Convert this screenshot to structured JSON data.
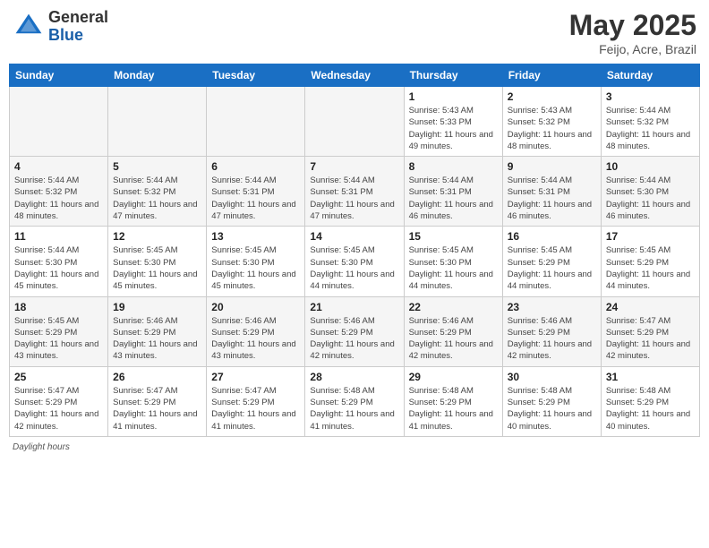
{
  "header": {
    "logo_general": "General",
    "logo_blue": "Blue",
    "title": "May 2025",
    "location": "Feijo, Acre, Brazil"
  },
  "days_of_week": [
    "Sunday",
    "Monday",
    "Tuesday",
    "Wednesday",
    "Thursday",
    "Friday",
    "Saturday"
  ],
  "weeks": [
    [
      {
        "day": "",
        "info": ""
      },
      {
        "day": "",
        "info": ""
      },
      {
        "day": "",
        "info": ""
      },
      {
        "day": "",
        "info": ""
      },
      {
        "day": "1",
        "info": "Sunrise: 5:43 AM\nSunset: 5:33 PM\nDaylight: 11 hours and 49 minutes."
      },
      {
        "day": "2",
        "info": "Sunrise: 5:43 AM\nSunset: 5:32 PM\nDaylight: 11 hours and 48 minutes."
      },
      {
        "day": "3",
        "info": "Sunrise: 5:44 AM\nSunset: 5:32 PM\nDaylight: 11 hours and 48 minutes."
      }
    ],
    [
      {
        "day": "4",
        "info": "Sunrise: 5:44 AM\nSunset: 5:32 PM\nDaylight: 11 hours and 48 minutes."
      },
      {
        "day": "5",
        "info": "Sunrise: 5:44 AM\nSunset: 5:32 PM\nDaylight: 11 hours and 47 minutes."
      },
      {
        "day": "6",
        "info": "Sunrise: 5:44 AM\nSunset: 5:31 PM\nDaylight: 11 hours and 47 minutes."
      },
      {
        "day": "7",
        "info": "Sunrise: 5:44 AM\nSunset: 5:31 PM\nDaylight: 11 hours and 47 minutes."
      },
      {
        "day": "8",
        "info": "Sunrise: 5:44 AM\nSunset: 5:31 PM\nDaylight: 11 hours and 46 minutes."
      },
      {
        "day": "9",
        "info": "Sunrise: 5:44 AM\nSunset: 5:31 PM\nDaylight: 11 hours and 46 minutes."
      },
      {
        "day": "10",
        "info": "Sunrise: 5:44 AM\nSunset: 5:30 PM\nDaylight: 11 hours and 46 minutes."
      }
    ],
    [
      {
        "day": "11",
        "info": "Sunrise: 5:44 AM\nSunset: 5:30 PM\nDaylight: 11 hours and 45 minutes."
      },
      {
        "day": "12",
        "info": "Sunrise: 5:45 AM\nSunset: 5:30 PM\nDaylight: 11 hours and 45 minutes."
      },
      {
        "day": "13",
        "info": "Sunrise: 5:45 AM\nSunset: 5:30 PM\nDaylight: 11 hours and 45 minutes."
      },
      {
        "day": "14",
        "info": "Sunrise: 5:45 AM\nSunset: 5:30 PM\nDaylight: 11 hours and 44 minutes."
      },
      {
        "day": "15",
        "info": "Sunrise: 5:45 AM\nSunset: 5:30 PM\nDaylight: 11 hours and 44 minutes."
      },
      {
        "day": "16",
        "info": "Sunrise: 5:45 AM\nSunset: 5:29 PM\nDaylight: 11 hours and 44 minutes."
      },
      {
        "day": "17",
        "info": "Sunrise: 5:45 AM\nSunset: 5:29 PM\nDaylight: 11 hours and 44 minutes."
      }
    ],
    [
      {
        "day": "18",
        "info": "Sunrise: 5:45 AM\nSunset: 5:29 PM\nDaylight: 11 hours and 43 minutes."
      },
      {
        "day": "19",
        "info": "Sunrise: 5:46 AM\nSunset: 5:29 PM\nDaylight: 11 hours and 43 minutes."
      },
      {
        "day": "20",
        "info": "Sunrise: 5:46 AM\nSunset: 5:29 PM\nDaylight: 11 hours and 43 minutes."
      },
      {
        "day": "21",
        "info": "Sunrise: 5:46 AM\nSunset: 5:29 PM\nDaylight: 11 hours and 42 minutes."
      },
      {
        "day": "22",
        "info": "Sunrise: 5:46 AM\nSunset: 5:29 PM\nDaylight: 11 hours and 42 minutes."
      },
      {
        "day": "23",
        "info": "Sunrise: 5:46 AM\nSunset: 5:29 PM\nDaylight: 11 hours and 42 minutes."
      },
      {
        "day": "24",
        "info": "Sunrise: 5:47 AM\nSunset: 5:29 PM\nDaylight: 11 hours and 42 minutes."
      }
    ],
    [
      {
        "day": "25",
        "info": "Sunrise: 5:47 AM\nSunset: 5:29 PM\nDaylight: 11 hours and 42 minutes."
      },
      {
        "day": "26",
        "info": "Sunrise: 5:47 AM\nSunset: 5:29 PM\nDaylight: 11 hours and 41 minutes."
      },
      {
        "day": "27",
        "info": "Sunrise: 5:47 AM\nSunset: 5:29 PM\nDaylight: 11 hours and 41 minutes."
      },
      {
        "day": "28",
        "info": "Sunrise: 5:48 AM\nSunset: 5:29 PM\nDaylight: 11 hours and 41 minutes."
      },
      {
        "day": "29",
        "info": "Sunrise: 5:48 AM\nSunset: 5:29 PM\nDaylight: 11 hours and 41 minutes."
      },
      {
        "day": "30",
        "info": "Sunrise: 5:48 AM\nSunset: 5:29 PM\nDaylight: 11 hours and 40 minutes."
      },
      {
        "day": "31",
        "info": "Sunrise: 5:48 AM\nSunset: 5:29 PM\nDaylight: 11 hours and 40 minutes."
      }
    ]
  ],
  "footer": {
    "label": "Daylight hours"
  }
}
